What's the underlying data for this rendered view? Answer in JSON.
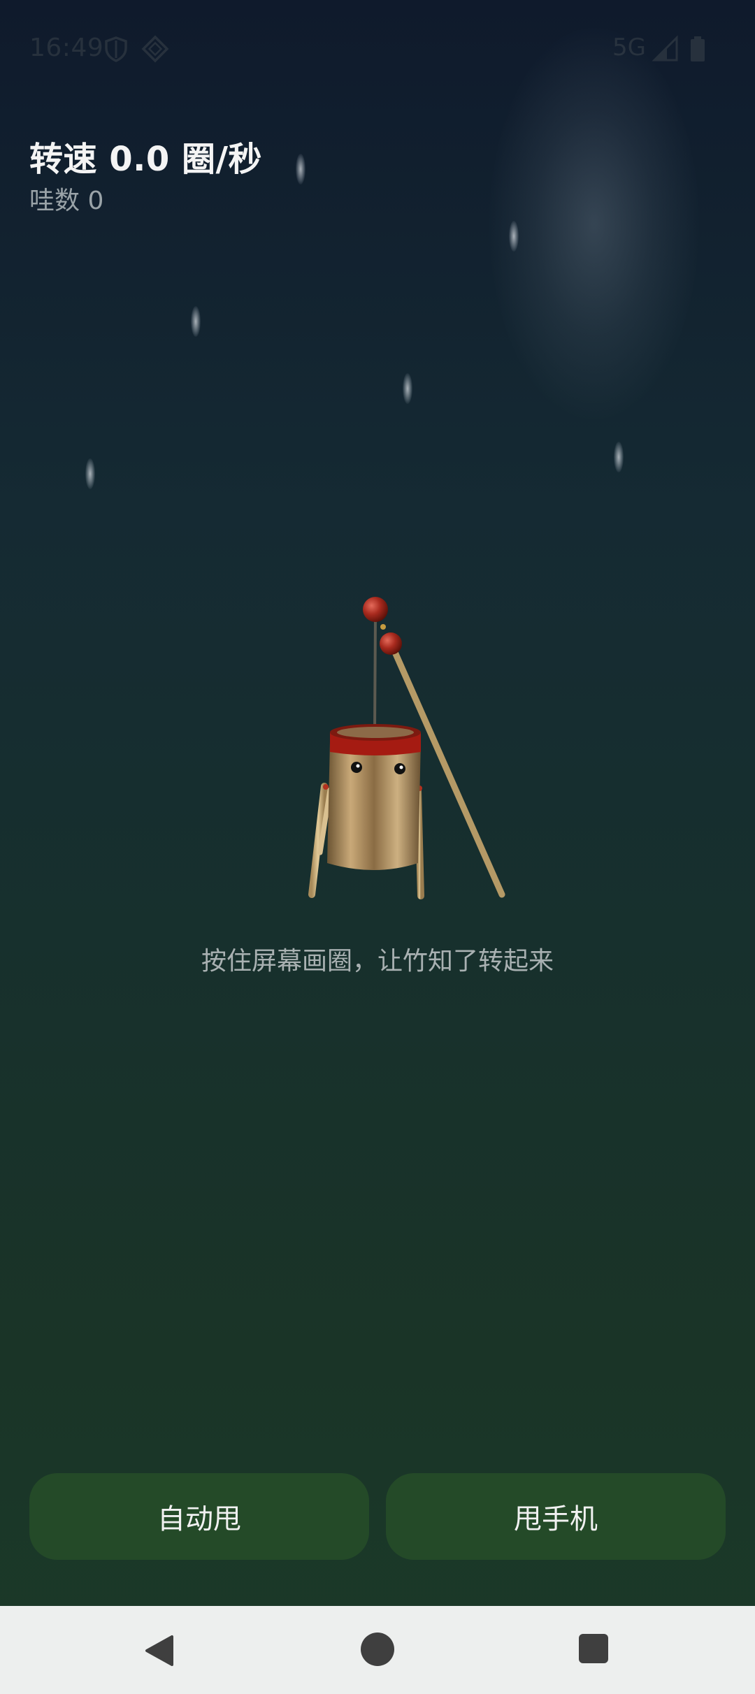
{
  "status_bar": {
    "time": "16:49",
    "network": "5G",
    "icons": [
      "shield-icon",
      "vpn-diamond-icon",
      "signal-icon",
      "battery-icon"
    ]
  },
  "info": {
    "speed_label": "转速 0.0 圈/秒",
    "count_label": "哇数 0"
  },
  "hint": "按住屏幕画圈，让竹知了转起来",
  "buttons": {
    "auto_label": "自动甩",
    "shake_label": "甩手机"
  },
  "nav_bar": {
    "icons": [
      "back-icon",
      "home-icon",
      "recents-icon"
    ]
  },
  "colors": {
    "button_bg": "#244a28",
    "nav_bg": "#edefee",
    "background_top": "#0f1a2c",
    "background_bottom": "#1b3a29"
  }
}
